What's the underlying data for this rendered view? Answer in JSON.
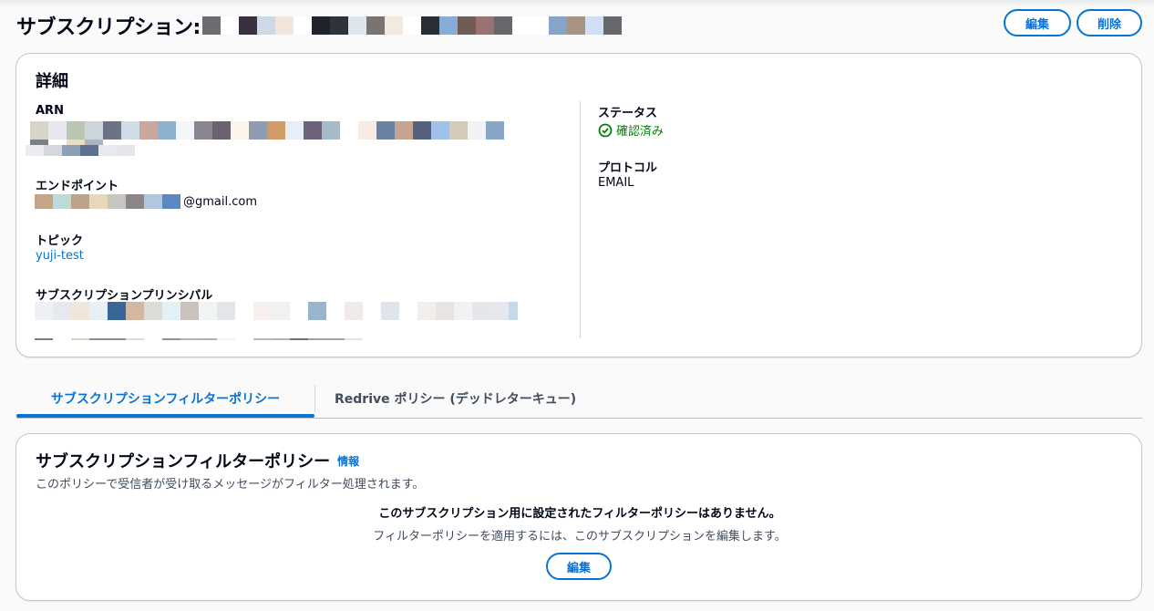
{
  "page": {
    "title": "サブスクリプション:",
    "buttons": {
      "edit": "編集",
      "delete": "削除"
    }
  },
  "details": {
    "heading": "詳細",
    "arn_label": "ARN",
    "endpoint_label": "エンドポイント",
    "endpoint_suffix": "@gmail.com",
    "topic_label": "トピック",
    "topic_value": "yuji-test",
    "principal_label": "サブスクリプションプリンシパル",
    "status_label": "ステータス",
    "status_value": "確認済み",
    "protocol_label": "プロトコル",
    "protocol_value": "EMAIL"
  },
  "tabs": [
    {
      "label": "サブスクリプションフィルターポリシー",
      "active": true
    },
    {
      "label": "Redrive ポリシー (デッドレターキュー)",
      "active": false
    }
  ],
  "filter_policy": {
    "heading": "サブスクリプションフィルターポリシー",
    "info_link": "情報",
    "description": "このポリシーで受信者が受け取るメッセージがフィルター処理されます。",
    "empty_title": "このサブスクリプション用に設定されたフィルターポリシーはありません。",
    "empty_hint": "フィルターポリシーを適用するには、このサブスクリプションを編集します。",
    "edit_button": "編集"
  },
  "colors": {
    "accent": "#0972d3",
    "success": "#037f0c",
    "border": "#c6c6cd"
  }
}
